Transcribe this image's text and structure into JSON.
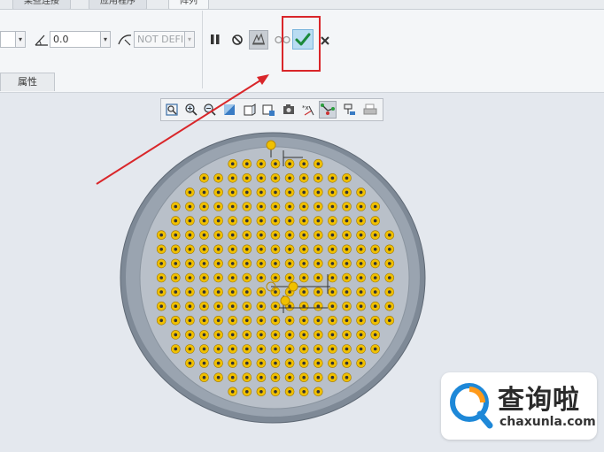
{
  "tabs": [
    {
      "label": "某些连接"
    },
    {
      "label": "应用程序"
    },
    {
      "label": "阵列"
    }
  ],
  "dashboard": {
    "angle_value": "0.0",
    "ref_value": "NOT DEFIN",
    "properties_tab": "属性"
  },
  "icons": {
    "pause": "pause-icon",
    "stop": "no-entry-icon",
    "preview": "preview-icon",
    "verify": "glasses-icon",
    "ok": "checkmark-icon",
    "cancel": "close-icon"
  },
  "highlight_color": "#d9262a",
  "part_color": "#8c96a2",
  "hole_color": "#f0c000",
  "watermark": {
    "cn": "查询啦",
    "en": "chaxunla.com"
  }
}
